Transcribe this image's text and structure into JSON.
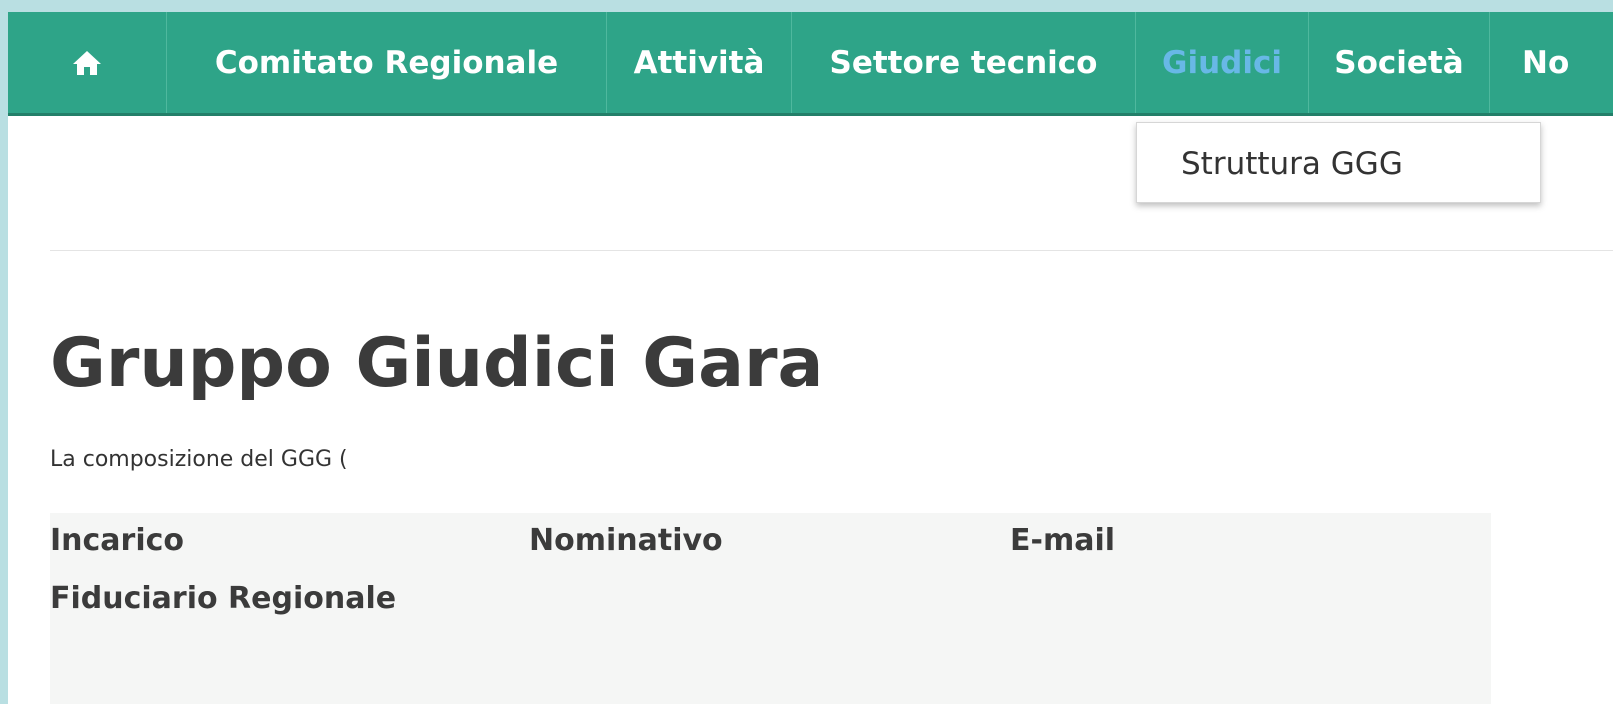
{
  "nav": {
    "items": [
      {
        "label": "Comitato Regionale"
      },
      {
        "label": "Attività"
      },
      {
        "label": "Settore tecnico"
      },
      {
        "label": "Giudici",
        "active": true
      },
      {
        "label": "Società"
      },
      {
        "label": "No"
      }
    ],
    "home_icon": "home-icon",
    "accent_color": "#2ea488",
    "active_color": "#68b8e6"
  },
  "dropdown": {
    "items": [
      {
        "label": "Struttura GGG"
      }
    ]
  },
  "main": {
    "title": "Gruppo Giudici Gara",
    "intro": "La composizione del GGG (",
    "table": {
      "headers": [
        "Incarico",
        "Nominativo",
        "E-mail"
      ],
      "rows": [
        [
          "Fiduciario Regionale",
          "",
          ""
        ]
      ]
    }
  }
}
